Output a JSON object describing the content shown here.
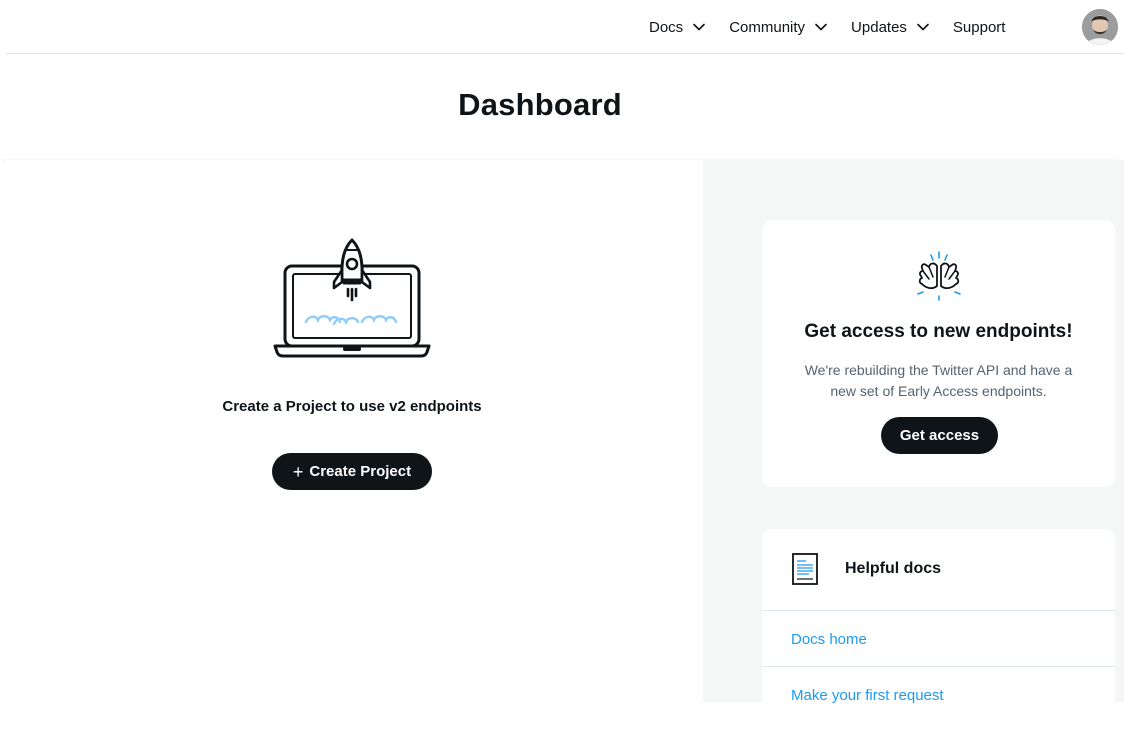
{
  "nav": {
    "items": [
      {
        "label": "Docs",
        "has_dropdown": true
      },
      {
        "label": "Community",
        "has_dropdown": true
      },
      {
        "label": "Updates",
        "has_dropdown": true
      },
      {
        "label": "Support",
        "has_dropdown": false
      }
    ],
    "avatar_icon": "user-avatar"
  },
  "page": {
    "title": "Dashboard"
  },
  "create_project": {
    "illustration": "rocket-laptop-icon",
    "prompt": "Create a Project to use v2 endpoints",
    "button_label": "Create Project",
    "button_icon": "plus"
  },
  "access_card": {
    "icon": "high-five-icon",
    "title": "Get access to new endpoints!",
    "description": "We're rebuilding the Twitter API and have a new set of Early Access endpoints.",
    "button_label": "Get access"
  },
  "docs_card": {
    "icon": "document-icon",
    "title": "Helpful docs",
    "links": [
      {
        "label": "Docs home"
      },
      {
        "label": "Make your first request"
      }
    ]
  },
  "colors": {
    "primary_button": "#0f1419",
    "link": "#1d9bf0",
    "side_panel_bg": "#f5f7f7",
    "muted_text": "#536471",
    "accent_blue": "#8ecdf8"
  }
}
